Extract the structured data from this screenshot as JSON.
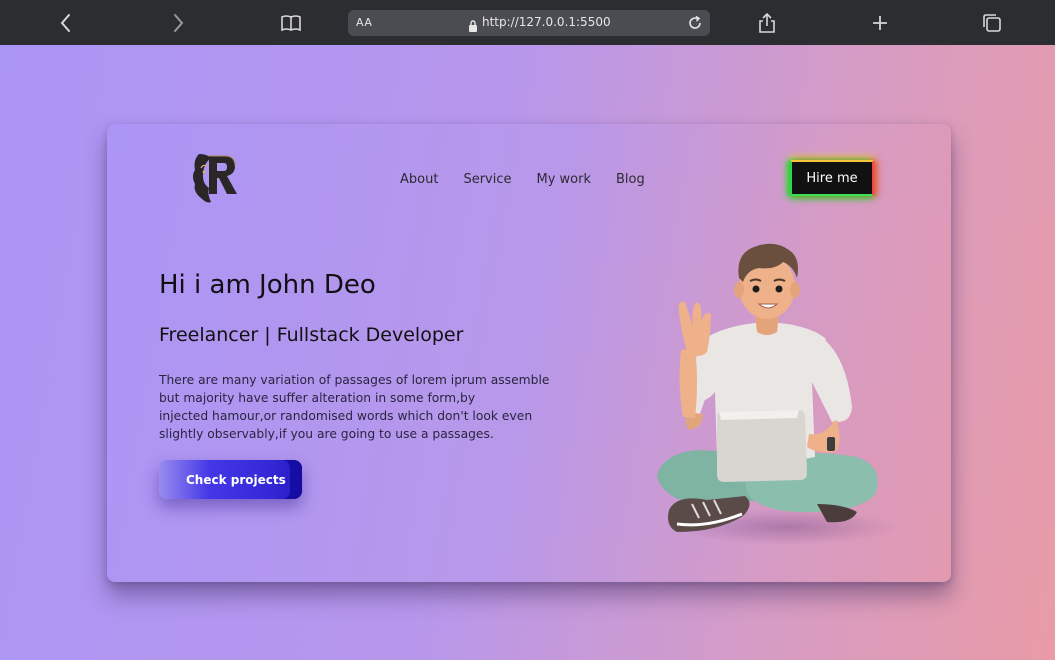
{
  "browser": {
    "url": "http://127.0.0.1:5500",
    "text_size_label": "AA"
  },
  "header": {
    "nav": [
      "About",
      "Service",
      "My work",
      "Blog"
    ],
    "hire_label": "Hire me"
  },
  "hero": {
    "title": "Hi i am John Deo",
    "subtitle": "Freelancer | Fullstack Developer",
    "description_lines": [
      "There are many variation of passages of lorem iprum assemble",
      "but majority have suffer alteration in some form,by",
      "injected hamour,or randomised words which don't look even",
      "slightly observably,if you are going to use a passages."
    ],
    "cta_label": "Check projects"
  },
  "logo": {
    "letter": "R"
  },
  "colors": {
    "page_bg_start": "#ab95f5",
    "page_bg_end": "#e99ba6",
    "button_primary": "#3327d6",
    "hire_bg": "#111111"
  }
}
